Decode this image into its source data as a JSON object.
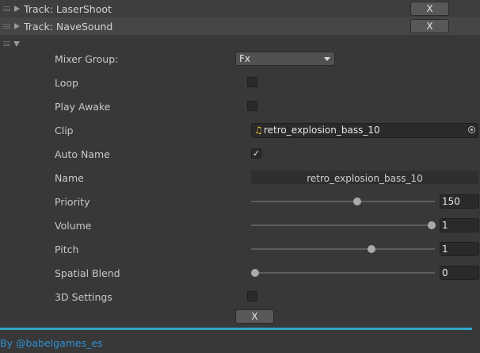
{
  "tracks": [
    {
      "title": "Track: LaserShoot",
      "remove_label": "X"
    },
    {
      "title": "Track: NaveSound",
      "remove_label": "X"
    }
  ],
  "expanded": {
    "mixer_group": {
      "label": "Mixer Group:",
      "value": "Fx"
    },
    "loop": {
      "label": "Loop",
      "checked": false
    },
    "play_awake": {
      "label": "Play Awake",
      "checked": false
    },
    "clip": {
      "label": "Clip",
      "value": "retro_explosion_bass_10",
      "icon": "audio-clip-icon"
    },
    "auto_name": {
      "label": "Auto Name",
      "checked": true,
      "check_glyph": "✓"
    },
    "name": {
      "label": "Name",
      "value": "retro_explosion_bass_10"
    },
    "priority": {
      "label": "Priority",
      "value": "150",
      "slider_fraction": 0.58
    },
    "volume": {
      "label": "Volume",
      "value": "1",
      "slider_fraction": 1.0
    },
    "pitch": {
      "label": "Pitch",
      "value": "1",
      "slider_fraction": 0.66
    },
    "spatial_blend": {
      "label": "Spatial Blend",
      "value": "0",
      "slider_fraction": 0.0
    },
    "settings_3d": {
      "label": "3D Settings",
      "checked": false
    },
    "remove_label": "X"
  },
  "footer": {
    "credit": "By @babelgames_es"
  },
  "colors": {
    "accent_line": "#2fa7c9",
    "credit_text": "#2f8fd0",
    "background": "#383838"
  }
}
